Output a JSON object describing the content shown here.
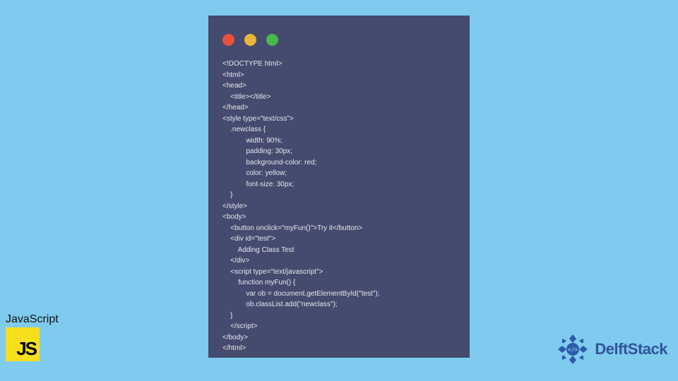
{
  "code_lines": [
    "<!DOCTYPE html>",
    "<html>",
    "<head>",
    "    <title></title>",
    "</head>",
    "<style type=\"text/css\">",
    "    .newclass {",
    "            width: 90%;",
    "            padding: 30px;",
    "            background-color: red;",
    "            color: yellow;",
    "            font-size: 30px;",
    "    }",
    "</style>",
    "<body>",
    "    <button onclick=\"myFun()\">Try it</button>",
    "    <div id=\"test\">",
    "        Adding Class Test",
    "    </div>",
    "    <script type=\"text/javascript\">",
    "        function myFun() {",
    "            var ob = document.getElementById(\"test\");",
    "            ob.classList.add(\"newclass\");",
    "    }",
    "    </script>",
    "</body>",
    "</html>"
  ],
  "js_badge": {
    "label": "JavaScript",
    "logo_text": "JS"
  },
  "brand": {
    "name": "DelftStack"
  }
}
